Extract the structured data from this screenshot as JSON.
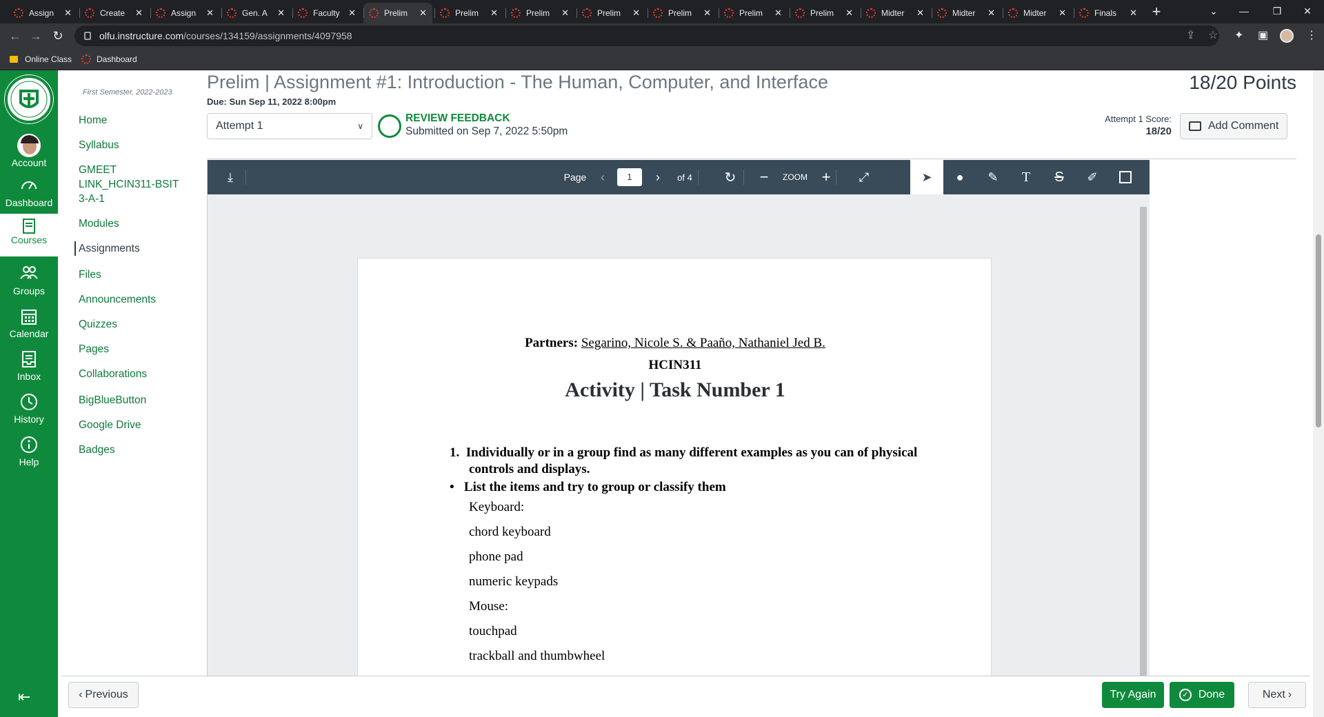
{
  "browser": {
    "tabs": [
      {
        "title": "Assign"
      },
      {
        "title": "Create"
      },
      {
        "title": "Assign"
      },
      {
        "title": "Gen. A"
      },
      {
        "title": "Faculty"
      },
      {
        "title": "Prelim"
      },
      {
        "title": "Prelim"
      },
      {
        "title": "Prelim"
      },
      {
        "title": "Prelim"
      },
      {
        "title": "Prelim"
      },
      {
        "title": "Prelim"
      },
      {
        "title": "Prelim"
      },
      {
        "title": "Midter"
      },
      {
        "title": "Midter"
      },
      {
        "title": "Midter"
      },
      {
        "title": "Finals"
      }
    ],
    "active_tab_index": 5,
    "url_host": "olfu.instructure.com",
    "url_path": "/courses/134159/assignments/4097958",
    "bookmarks": [
      {
        "label": "Online Class",
        "icon": "folder-icon"
      },
      {
        "label": "Dashboard",
        "icon": "canvas-icon"
      }
    ]
  },
  "global_nav": {
    "items": [
      {
        "label": "Account",
        "icon": "avatar"
      },
      {
        "label": "Dashboard",
        "icon": "dashboard-icon"
      },
      {
        "label": "Courses",
        "icon": "courses-icon",
        "active": true
      },
      {
        "label": "Groups",
        "icon": "groups-icon"
      },
      {
        "label": "Calendar",
        "icon": "calendar-icon"
      },
      {
        "label": "Inbox",
        "icon": "inbox-icon"
      },
      {
        "label": "History",
        "icon": "history-icon"
      },
      {
        "label": "Help",
        "icon": "help-icon"
      }
    ],
    "brand_color": "#0f8a3c"
  },
  "course_nav": {
    "term": "First Semester, 2022-2023",
    "items": [
      {
        "label": "Home"
      },
      {
        "label": "Syllabus"
      },
      {
        "label": "GMEET LINK_HCIN311-BSIT 3-A-1"
      },
      {
        "label": "Modules"
      },
      {
        "label": "Assignments",
        "active": true
      },
      {
        "label": "Files"
      },
      {
        "label": "Announcements"
      },
      {
        "label": "Quizzes"
      },
      {
        "label": "Pages"
      },
      {
        "label": "Collaborations"
      },
      {
        "label": "BigBlueButton"
      },
      {
        "label": "Google Drive"
      },
      {
        "label": "Badges"
      }
    ]
  },
  "assignment": {
    "title": "Prelim | Assignment #1: Introduction - The Human, Computer, and Interface",
    "points": "18/20",
    "points_label": "Points",
    "due": "Due: Sun Sep 11, 2022 8:00pm",
    "attempt_selected": "Attempt 1",
    "review_title": "REVIEW FEEDBACK",
    "review_sub": "Submitted on Sep 7, 2022 5:50pm",
    "attempt_score_label": "Attempt 1 Score:",
    "attempt_score_value": "18/20",
    "add_comment": "Add Comment"
  },
  "viewer": {
    "page_label": "Page",
    "page_current": "1",
    "page_of": "of 4",
    "zoom_label": "ZOOM"
  },
  "pdf": {
    "partners_label": "Partners:",
    "partners": "Segarino, Nicole S. & Paaño, Nathaniel Jed B.",
    "course": "HCIN311",
    "heading": "Activity | Task Number 1",
    "q1": "1.  Individually or in a group find as many different examples as you can of physical controls and displays.",
    "bullet": "•   List the items and try to group or classify them",
    "lines": [
      "Keyboard:",
      "chord keyboard",
      "phone pad",
      "numeric keypads",
      "Mouse:",
      "touchpad",
      "trackball and thumbwheel"
    ]
  },
  "footer": {
    "previous": "Previous",
    "try_again": "Try Again",
    "done": "Done",
    "next": "Next"
  }
}
